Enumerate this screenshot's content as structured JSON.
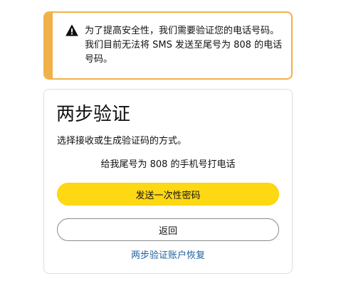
{
  "alert": {
    "icon": "warning-icon",
    "message": "为了提高安全性，我们需要验证您的电话号码。我们目前无法将 SMS 发送至尾号为 808 的电话号码。",
    "accent_color": "#f0b14a"
  },
  "card": {
    "title": "两步验证",
    "subtitle": "选择接收或生成验证码的方式。",
    "call_option": "给我尾号为 808 的手机号打电话",
    "send_otp_button": "发送一次性密码",
    "back_button": "返回",
    "recovery_link": "两步验证账户恢复"
  },
  "colors": {
    "primary_button": "#ffd814",
    "link": "#2162a1"
  }
}
